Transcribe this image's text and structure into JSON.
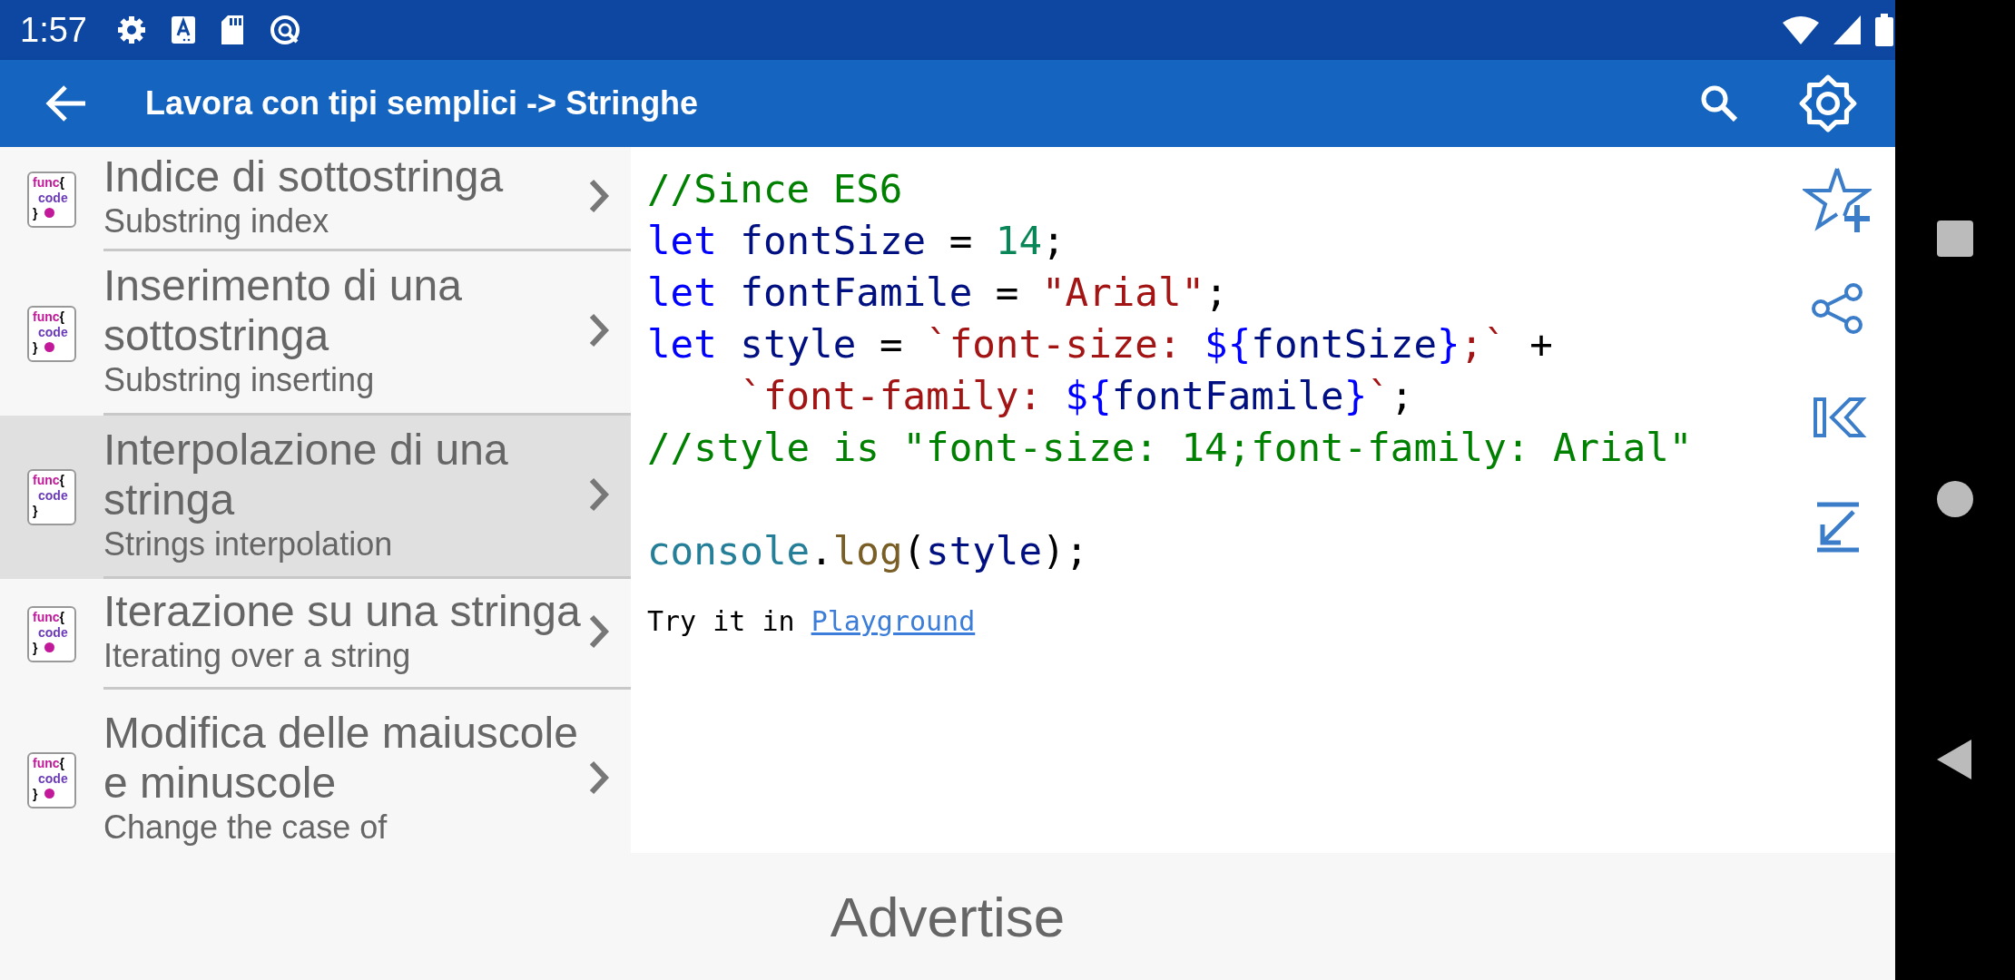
{
  "status_bar": {
    "time": "1:57"
  },
  "app_bar": {
    "title": "Lavora con tipi semplici -> Stringhe"
  },
  "topics": [
    {
      "title": "Indice di sottostringa",
      "subtitle": "Substring index",
      "selected": false,
      "icon": {
        "top": "func",
        "brace_open": "{",
        "middle": "code",
        "brace_close": "}",
        "dot": true
      }
    },
    {
      "title": "Inserimento di una sottostringa",
      "subtitle": "Substring inserting",
      "selected": false,
      "icon": {
        "top": "func",
        "brace_open": "{",
        "middle": "code",
        "brace_close": "}",
        "dot": true
      }
    },
    {
      "title": "Interpolazione di una stringa",
      "subtitle": "Strings interpolation",
      "selected": true,
      "icon": {
        "top": "func",
        "brace_open": "{",
        "middle": "code",
        "brace_close": "}",
        "dot": false
      }
    },
    {
      "title": "Iterazione su una stringa",
      "subtitle": "Iterating over a string",
      "selected": false,
      "icon": {
        "top": "func",
        "brace_open": "{",
        "middle": "code",
        "brace_close": "}",
        "dot": true
      }
    },
    {
      "title": "Modifica delle maiuscole e minuscole",
      "subtitle": "Change the case of",
      "selected": false,
      "icon": {
        "top": "func",
        "brace_open": "{",
        "middle": "code",
        "brace_close": "}",
        "dot": true
      }
    }
  ],
  "code_blocks": [
    {
      "lines": [
        [
          {
            "text": "//Since ES6",
            "kind": "comment"
          }
        ],
        [
          {
            "text": "let",
            "kind": "keyword"
          },
          {
            "text": " fontSize",
            "kind": "ident"
          },
          {
            "text": " = ",
            "kind": "punct"
          },
          {
            "text": "14",
            "kind": "number"
          },
          {
            "text": ";",
            "kind": "punct"
          }
        ],
        [
          {
            "text": "let",
            "kind": "keyword"
          },
          {
            "text": " fontFamile",
            "kind": "ident"
          },
          {
            "text": " = ",
            "kind": "punct"
          },
          {
            "text": "\"Arial\"",
            "kind": "string"
          },
          {
            "text": ";",
            "kind": "punct"
          }
        ],
        [
          {
            "text": "let",
            "kind": "keyword"
          },
          {
            "text": " style",
            "kind": "ident"
          },
          {
            "text": " = ",
            "kind": "punct"
          },
          {
            "text": "`font-size: ",
            "kind": "string"
          },
          {
            "text": "${",
            "kind": "keyword"
          },
          {
            "text": "fontSize",
            "kind": "ident"
          },
          {
            "text": "}",
            "kind": "keyword"
          },
          {
            "text": ";`",
            "kind": "string"
          },
          {
            "text": " +",
            "kind": "punct"
          }
        ],
        [
          {
            "text": "    `font-family: ",
            "kind": "string"
          },
          {
            "text": "${",
            "kind": "keyword"
          },
          {
            "text": "fontFamile",
            "kind": "ident"
          },
          {
            "text": "}",
            "kind": "keyword"
          },
          {
            "text": "`",
            "kind": "string"
          },
          {
            "text": ";",
            "kind": "punct"
          }
        ],
        [
          {
            "text": "//style is \"font-size: 14;font-family: Arial\"",
            "kind": "comment"
          }
        ]
      ]
    },
    {
      "lines": [
        [
          {
            "text": "console",
            "kind": "object"
          },
          {
            "text": ".",
            "kind": "punct"
          },
          {
            "text": "log",
            "kind": "func"
          },
          {
            "text": "(",
            "kind": "punct"
          },
          {
            "text": "style",
            "kind": "ident"
          },
          {
            "text": ");",
            "kind": "punct"
          }
        ]
      ]
    }
  ],
  "try_it": {
    "text": "Try it in",
    "link": "Playground"
  },
  "ad_banner": {
    "text": "Advertise"
  }
}
